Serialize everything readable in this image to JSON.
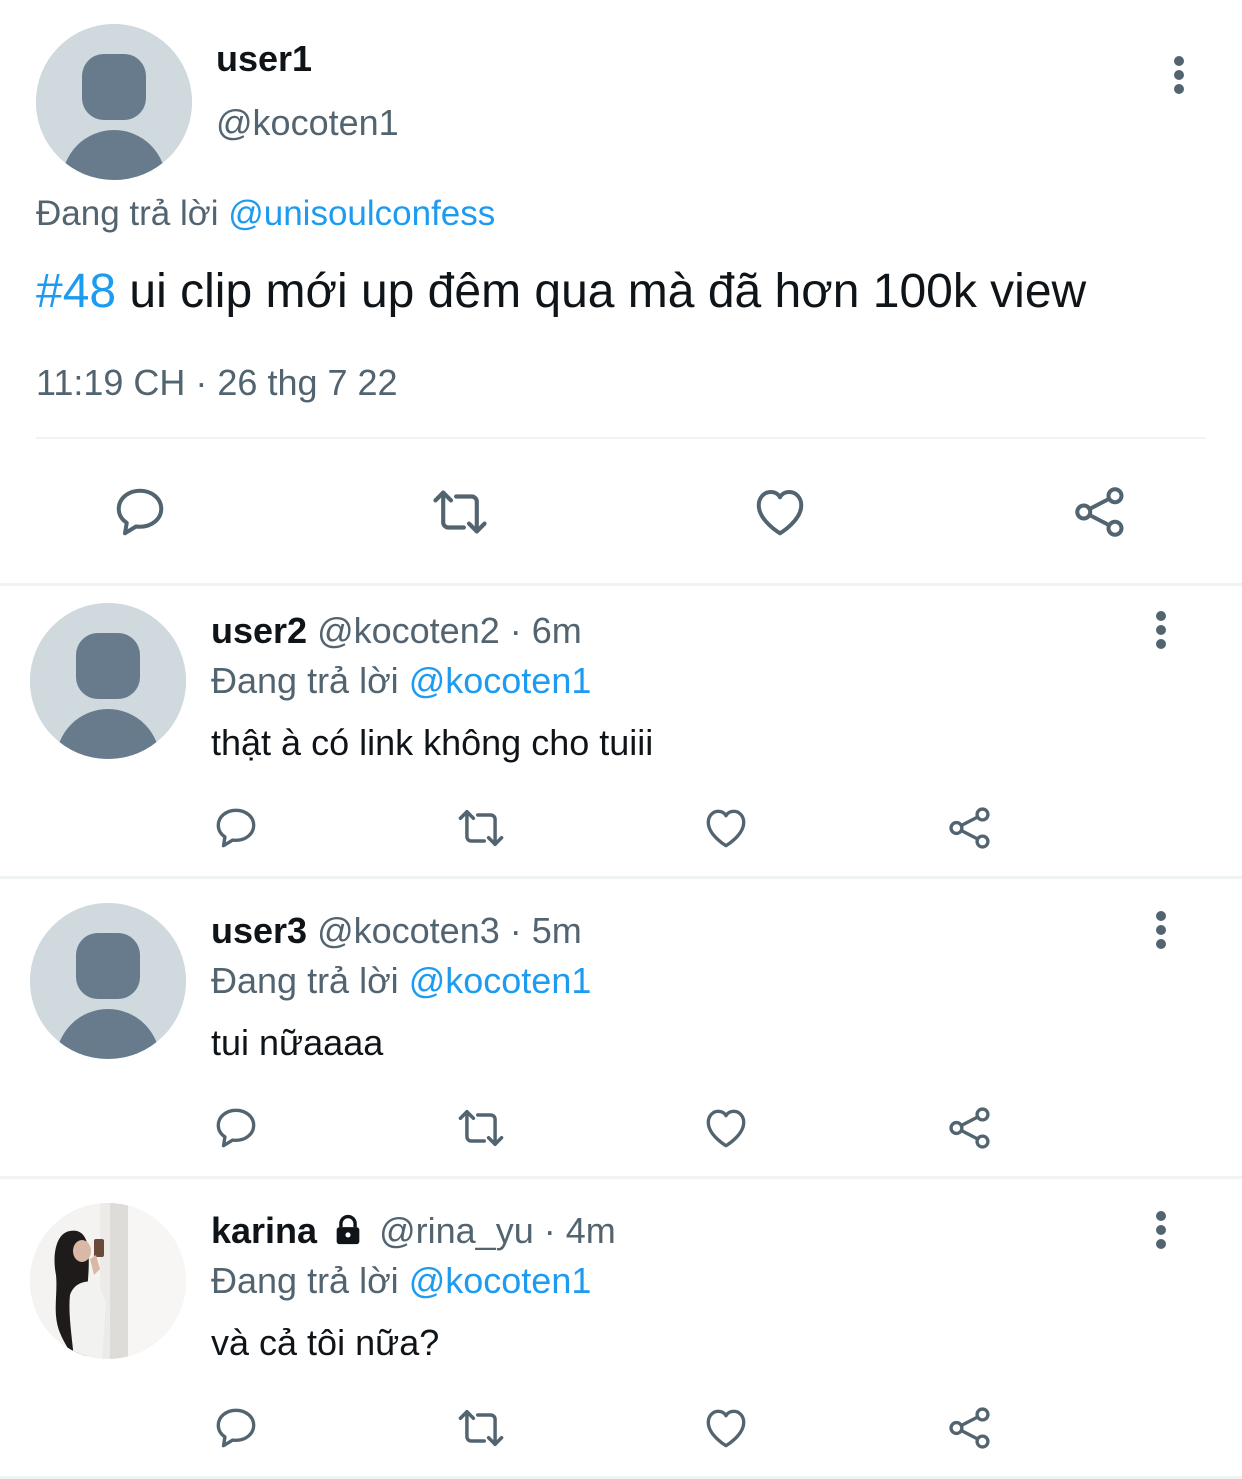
{
  "main_tweet": {
    "display_name": "user1",
    "handle": "@kocoten1",
    "replying_prefix": "Đang trả lời",
    "replying_to": "@unisoulconfess",
    "hashtag": "#48",
    "text": " ui clip mới up đêm qua mà đã hơn 100k view",
    "timestamp": "11:19 CH · 26 thg 7 22",
    "avatar_icon": "default-avatar-icon",
    "more_icon": "more-vertical-icon"
  },
  "replies": [
    {
      "display_name": "user2",
      "handle": "@kocoten2",
      "time": " · 6m",
      "replying_prefix": "Đang trả lời",
      "replying_to": "@kocoten1",
      "text": "thật à có link không cho tuiii",
      "avatar_icon": "default-avatar-icon"
    },
    {
      "display_name": "user3",
      "handle": "@kocoten3",
      "time": " · 5m",
      "replying_prefix": "Đang trả lời",
      "replying_to": "@kocoten1",
      "text": "tui nữaaaa",
      "avatar_icon": "default-avatar-icon"
    },
    {
      "display_name": "karina",
      "handle": "@rina_yu",
      "time": " · 4m",
      "replying_prefix": "Đang trả lời",
      "replying_to": "@kocoten1",
      "text": "và cả tôi nữa?",
      "avatar_icon": "profile-photo-avatar",
      "protected_icon": "lock-icon"
    }
  ],
  "actions": [
    "reply-icon",
    "retweet-icon",
    "like-icon",
    "share-icon"
  ],
  "colors": {
    "link": "#1d9bf0",
    "text": "#0f1419",
    "muted": "#536471",
    "divider": "#eff3f4",
    "avatar_bg": "#cfd9de",
    "avatar_fg": "#687b8c"
  }
}
